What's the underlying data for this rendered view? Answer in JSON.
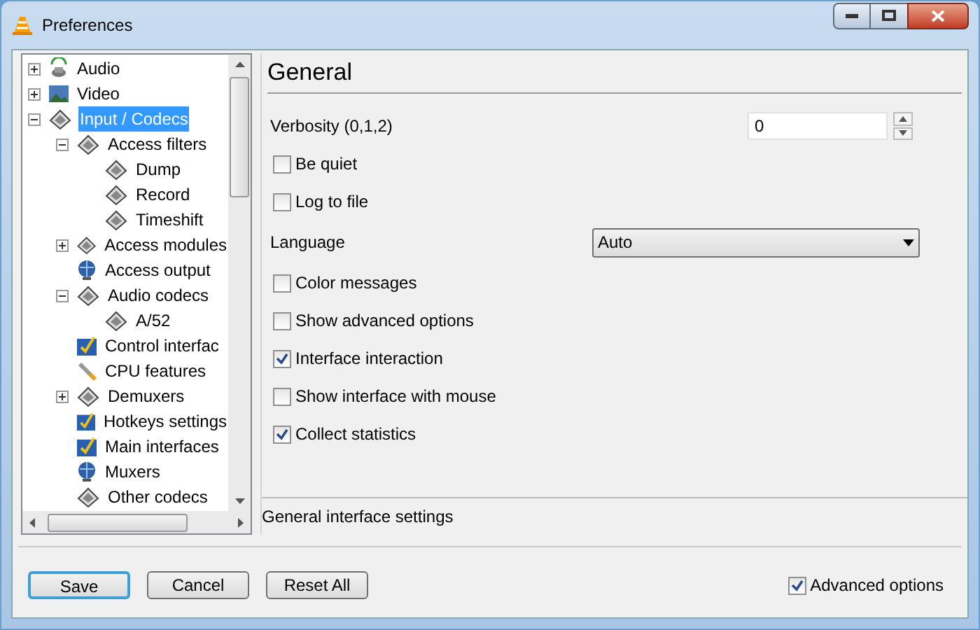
{
  "window": {
    "title": "Preferences"
  },
  "tree": [
    {
      "label": "Audio",
      "kind": "speaker",
      "expanded": false,
      "selected": false
    },
    {
      "label": "Video",
      "kind": "picture",
      "expanded": false,
      "selected": false
    },
    {
      "label": "Input / Codecs",
      "kind": "module",
      "expanded": true,
      "selected": true,
      "children": [
        {
          "label": "Access filters",
          "kind": "module",
          "expanded": true,
          "selected": false,
          "children": [
            {
              "label": "Dump",
              "kind": "module",
              "selected": false
            },
            {
              "label": "Record",
              "kind": "module",
              "selected": false
            },
            {
              "label": "Timeshift",
              "kind": "module",
              "selected": false
            }
          ]
        },
        {
          "label": "Access modules",
          "kind": "module",
          "expanded": false,
          "selected": false
        },
        {
          "label": "Access output",
          "kind": "globe",
          "selected": false
        },
        {
          "label": "Audio codecs",
          "kind": "module",
          "expanded": true,
          "selected": false,
          "children": [
            {
              "label": "A/52",
              "kind": "module",
              "selected": false
            }
          ]
        },
        {
          "label": "Control interfac",
          "kind": "panel",
          "selected": false
        },
        {
          "label": "CPU features",
          "kind": "wrench",
          "selected": false
        },
        {
          "label": "Demuxers",
          "kind": "module",
          "expanded": false,
          "selected": false
        },
        {
          "label": "Hotkeys settings",
          "kind": "panel",
          "selected": false
        },
        {
          "label": "Main interfaces",
          "kind": "panel",
          "selected": false
        },
        {
          "label": "Muxers",
          "kind": "globe",
          "selected": false
        },
        {
          "label": "Other codecs",
          "kind": "module",
          "selected": false
        }
      ]
    }
  ],
  "panel": {
    "title": "General",
    "description": "General interface settings",
    "settings": [
      {
        "kind": "spin",
        "label": "Verbosity (0,1,2)",
        "value": "0"
      },
      {
        "kind": "checkbox",
        "label": "Be quiet",
        "checked": false
      },
      {
        "kind": "checkbox",
        "label": "Log to file",
        "checked": false
      },
      {
        "kind": "select",
        "label": "Language",
        "value": "Auto"
      },
      {
        "kind": "checkbox",
        "label": "Color messages",
        "checked": false
      },
      {
        "kind": "checkbox",
        "label": "Show advanced options",
        "checked": false
      },
      {
        "kind": "checkbox",
        "label": "Interface interaction",
        "checked": true
      },
      {
        "kind": "checkbox",
        "label": "Show interface with mouse",
        "checked": false
      },
      {
        "kind": "checkbox",
        "label": "Collect statistics",
        "checked": true
      }
    ]
  },
  "buttons": [
    {
      "label": "Save",
      "default": true
    },
    {
      "label": "Cancel",
      "default": false
    },
    {
      "label": "Reset All",
      "default": false
    }
  ],
  "advanced": {
    "label": "Advanced options",
    "checked": true
  }
}
